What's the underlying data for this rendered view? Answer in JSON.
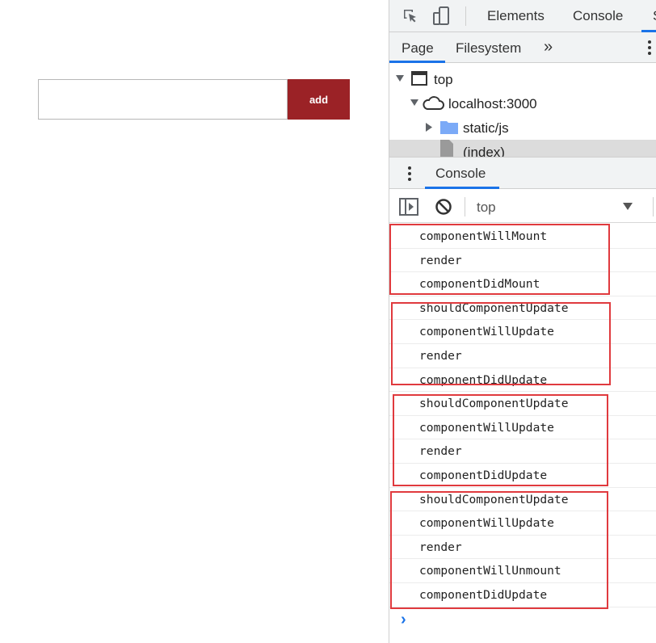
{
  "app": {
    "input_value": "",
    "add_label": "add"
  },
  "devtools": {
    "tabs": [
      "Elements",
      "Console",
      "S"
    ],
    "navigator_tabs": [
      "Page",
      "Filesystem"
    ],
    "more_tabs": "»",
    "tree": {
      "frame": "top",
      "origin": "localhost:3000",
      "folder": "static/js",
      "file": "(index)"
    },
    "drawer_tab": "Console",
    "context_select": "top",
    "logs": [
      "componentWillMount",
      "render",
      "componentDidMount",
      "shouldComponentUpdate",
      "componentWillUpdate",
      "render",
      "componentDidUpdate",
      "shouldComponentUpdate",
      "componentWillUpdate",
      "render",
      "componentDidUpdate",
      "shouldComponentUpdate",
      "componentWillUpdate",
      "render",
      "componentWillUnmount",
      "componentDidUpdate"
    ],
    "prompt_symbol": "›"
  },
  "colors": {
    "add_button": "#9b2226",
    "highlight_box": "#e03a3e",
    "active_tab_underline": "#1a73e8",
    "folder": "#7baaf7"
  }
}
